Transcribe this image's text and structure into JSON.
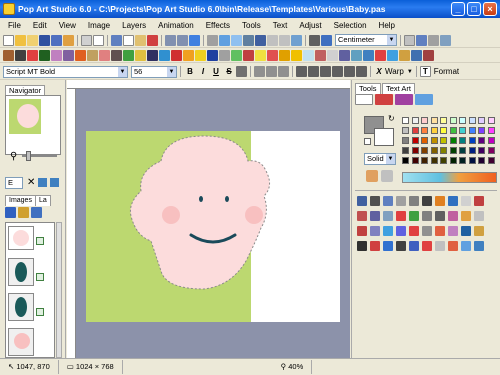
{
  "window": {
    "title": "Pop Art Studio 6.0 - C:\\Projects\\Pop Art Studio 6.0\\bin\\Release\\Templates\\Various\\Baby.pas"
  },
  "menu": [
    "File",
    "Edit",
    "View",
    "Image",
    "Layers",
    "Animation",
    "Effects",
    "Tools",
    "Text",
    "Adjust",
    "Selection",
    "Help"
  ],
  "toolbar1": {
    "unit_value": "Centimeter"
  },
  "toolbar3": {
    "font_value": "Script MT Bold",
    "size_value": "56",
    "warp_label": "Warp",
    "format_label": "Format"
  },
  "left_panel": {
    "navigator_tab": "Navigator",
    "images_tab": "Images",
    "layers_tab": "La",
    "zoom_select": "E"
  },
  "right_panel": {
    "tools_tab": "Tools",
    "text_art_tab": "Text Art",
    "fill_value": "Solid"
  },
  "status": {
    "coords": "1047, 870",
    "size": "1024 × 768",
    "zoom": "40%"
  },
  "palette": [
    "#ffffff",
    "#f0f0f0",
    "#ffcccc",
    "#ffe0a0",
    "#ffff99",
    "#ccffcc",
    "#ccffff",
    "#cce0ff",
    "#e0ccff",
    "#ffccff",
    "#c0c0c0",
    "#e04040",
    "#ff8040",
    "#ffd040",
    "#ffff40",
    "#40c040",
    "#40d0d0",
    "#4080ff",
    "#8040ff",
    "#ff40ff",
    "#808080",
    "#c00000",
    "#e06000",
    "#c09000",
    "#c0c000",
    "#008000",
    "#008080",
    "#0040c0",
    "#600080",
    "#c000c0",
    "#404040",
    "#800000",
    "#804000",
    "#806000",
    "#808000",
    "#004000",
    "#004040",
    "#002080",
    "#400060",
    "#800060",
    "#000000",
    "#400000",
    "#402000",
    "#403000",
    "#404000",
    "#002000",
    "#002020",
    "#001040",
    "#200030",
    "#400030"
  ]
}
